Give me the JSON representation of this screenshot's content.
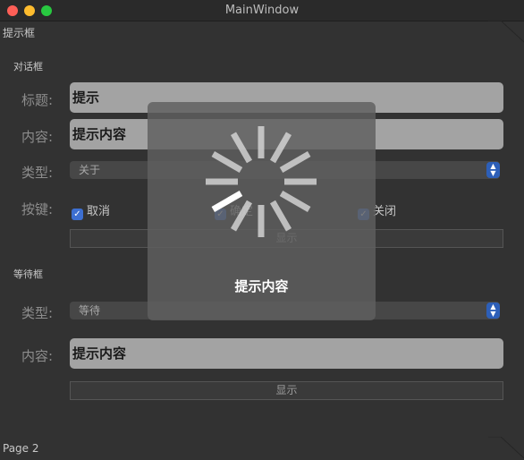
{
  "window": {
    "title": "MainWindow",
    "page_title": "提示框",
    "status_bar": "Page 2"
  },
  "dialog_section": {
    "heading": "对话框",
    "title_label": "标题:",
    "title_value": "提示",
    "content_label": "内容:",
    "content_value": "提示内容",
    "type_label": "类型:",
    "type_value": "关于",
    "buttons_label": "按键:",
    "checkboxes": [
      {
        "label": "取消",
        "checked": true
      },
      {
        "label": "确定",
        "checked": true
      },
      {
        "label": "关闭",
        "checked": true
      }
    ],
    "show_button": "显示"
  },
  "wait_section": {
    "heading": "等待框",
    "type_label": "类型:",
    "type_value": "等待",
    "content_label": "内容:",
    "content_value": "提示内容",
    "show_button": "显示"
  },
  "loading_overlay": {
    "message": "提示内容"
  },
  "colors": {
    "traffic_red": "#fe5f57",
    "traffic_yellow": "#febc2e",
    "traffic_green": "#28c840",
    "accent": "#3d6fd1"
  }
}
